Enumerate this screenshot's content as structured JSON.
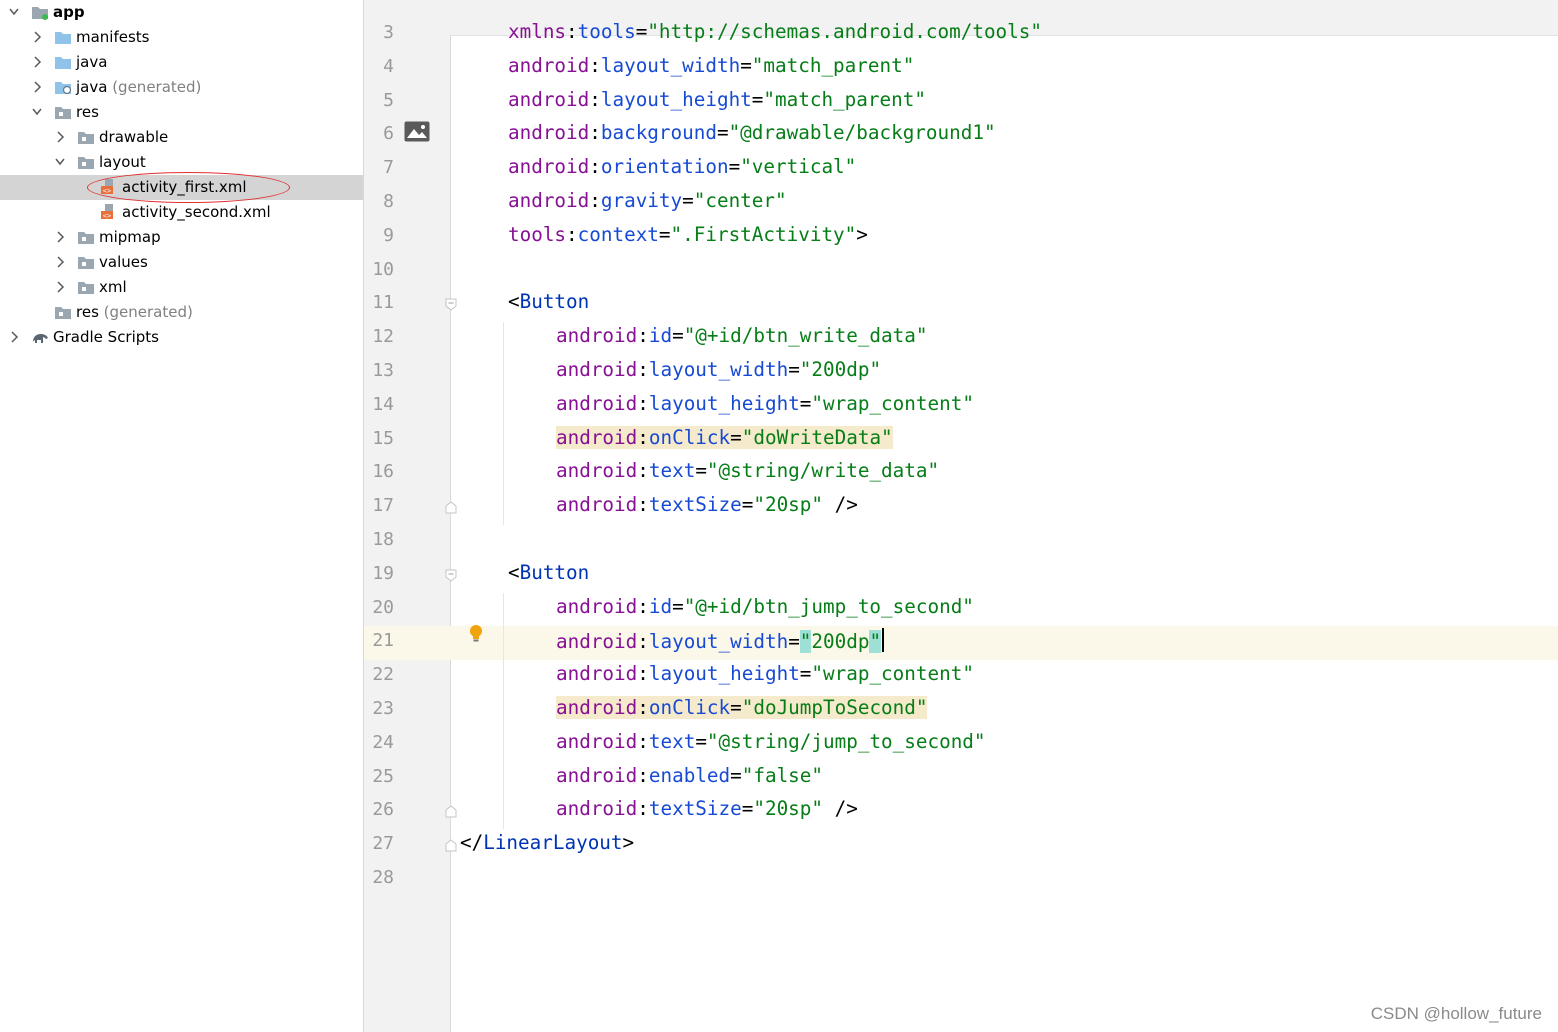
{
  "project_tree": [
    {
      "name": "tree-item-app",
      "label": "app",
      "icon": "module-folder-icon",
      "chevron": "down",
      "bold": true
    },
    {
      "name": "tree-item-manifests",
      "label": "manifests",
      "icon": "folder-icon",
      "chevron": "right"
    },
    {
      "name": "tree-item-java",
      "label": "java",
      "icon": "folder-icon",
      "chevron": "right"
    },
    {
      "name": "tree-item-java-generated",
      "label": "java",
      "suffix": "(generated)",
      "icon": "generated-java-folder-icon",
      "chevron": "right"
    },
    {
      "name": "tree-item-res",
      "label": "res",
      "icon": "resource-folder-icon",
      "chevron": "down"
    },
    {
      "name": "tree-item-drawable",
      "label": "drawable",
      "icon": "resource-folder-icon",
      "chevron": "right"
    },
    {
      "name": "tree-item-layout",
      "label": "layout",
      "icon": "resource-folder-icon",
      "chevron": "down"
    },
    {
      "name": "tree-item-activity-first",
      "label": "activity_first.xml",
      "icon": "xml-layout-file-icon",
      "selected": true
    },
    {
      "name": "tree-item-activity-second",
      "label": "activity_second.xml",
      "icon": "xml-layout-file-icon"
    },
    {
      "name": "tree-item-mipmap",
      "label": "mipmap",
      "icon": "resource-folder-icon",
      "chevron": "right"
    },
    {
      "name": "tree-item-values",
      "label": "values",
      "icon": "resource-folder-icon",
      "chevron": "right"
    },
    {
      "name": "tree-item-xml",
      "label": "xml",
      "icon": "resource-folder-icon",
      "chevron": "right"
    },
    {
      "name": "tree-item-res-generated",
      "label": "res",
      "suffix": "(generated)",
      "icon": "resource-folder-icon"
    },
    {
      "name": "tree-item-gradle-scripts",
      "label": "Gradle Scripts",
      "icon": "gradle-elephant-icon",
      "chevron": "right"
    }
  ],
  "editor": {
    "current_line": 21,
    "lines": [
      {
        "n": "3",
        "tokens": [
          [
            "ns",
            "xmlns"
          ],
          [
            "eq",
            ":"
          ],
          [
            "at",
            "tools"
          ],
          [
            "eq",
            "="
          ],
          [
            "st",
            "\"http://schemas.android.com/tools\""
          ]
        ]
      },
      {
        "n": "4",
        "tokens": [
          [
            "ns",
            "android"
          ],
          [
            "eq",
            ":"
          ],
          [
            "at",
            "layout_width"
          ],
          [
            "eq",
            "="
          ],
          [
            "st",
            "\"match_parent\""
          ]
        ]
      },
      {
        "n": "5",
        "tokens": [
          [
            "ns",
            "android"
          ],
          [
            "eq",
            ":"
          ],
          [
            "at",
            "layout_height"
          ],
          [
            "eq",
            "="
          ],
          [
            "st",
            "\"match_parent\""
          ]
        ]
      },
      {
        "n": "6",
        "tokens": [
          [
            "ns",
            "android"
          ],
          [
            "eq",
            ":"
          ],
          [
            "at",
            "background"
          ],
          [
            "eq",
            "="
          ],
          [
            "st",
            "\"@drawable/background1\""
          ]
        ]
      },
      {
        "n": "7",
        "tokens": [
          [
            "ns",
            "android"
          ],
          [
            "eq",
            ":"
          ],
          [
            "at",
            "orientation"
          ],
          [
            "eq",
            "="
          ],
          [
            "st",
            "\"vertical\""
          ]
        ]
      },
      {
        "n": "8",
        "tokens": [
          [
            "ns",
            "android"
          ],
          [
            "eq",
            ":"
          ],
          [
            "at",
            "gravity"
          ],
          [
            "eq",
            "="
          ],
          [
            "st",
            "\"center\""
          ]
        ]
      },
      {
        "n": "9",
        "tokens": [
          [
            "ns",
            "tools"
          ],
          [
            "eq",
            ":"
          ],
          [
            "at",
            "context"
          ],
          [
            "eq",
            "="
          ],
          [
            "st",
            "\".FirstActivity\""
          ],
          [
            "pu",
            ">"
          ]
        ]
      },
      {
        "n": "10",
        "tokens": []
      },
      {
        "n": "11",
        "tokens": [
          [
            "pu",
            "<"
          ],
          [
            "tg",
            "Button"
          ]
        ]
      },
      {
        "n": "12",
        "tokens": [
          [
            "ns",
            "android"
          ],
          [
            "eq",
            ":"
          ],
          [
            "at",
            "id"
          ],
          [
            "eq",
            "="
          ],
          [
            "st",
            "\"@+id/btn_write_data\""
          ]
        ]
      },
      {
        "n": "13",
        "tokens": [
          [
            "ns",
            "android"
          ],
          [
            "eq",
            ":"
          ],
          [
            "at",
            "layout_width"
          ],
          [
            "eq",
            "="
          ],
          [
            "st",
            "\"200dp\""
          ]
        ]
      },
      {
        "n": "14",
        "tokens": [
          [
            "ns",
            "android"
          ],
          [
            "eq",
            ":"
          ],
          [
            "at",
            "layout_height"
          ],
          [
            "eq",
            "="
          ],
          [
            "st",
            "\"wrap_content\""
          ]
        ]
      },
      {
        "n": "15",
        "highlight": true,
        "tokens": [
          [
            "ns",
            "android"
          ],
          [
            "eq",
            ":"
          ],
          [
            "at",
            "onClick"
          ],
          [
            "eq",
            "="
          ],
          [
            "st",
            "\"doWriteData\""
          ]
        ]
      },
      {
        "n": "16",
        "tokens": [
          [
            "ns",
            "android"
          ],
          [
            "eq",
            ":"
          ],
          [
            "at",
            "text"
          ],
          [
            "eq",
            "="
          ],
          [
            "st",
            "\"@string/write_data\""
          ]
        ]
      },
      {
        "n": "17",
        "tokens": [
          [
            "ns",
            "android"
          ],
          [
            "eq",
            ":"
          ],
          [
            "at",
            "textSize"
          ],
          [
            "eq",
            "="
          ],
          [
            "st",
            "\"20sp\""
          ],
          [
            "pu",
            " />"
          ]
        ]
      },
      {
        "n": "18",
        "tokens": []
      },
      {
        "n": "19",
        "tokens": [
          [
            "pu",
            "<"
          ],
          [
            "tg",
            "Button"
          ]
        ]
      },
      {
        "n": "20",
        "tokens": [
          [
            "ns",
            "android"
          ],
          [
            "eq",
            ":"
          ],
          [
            "at",
            "id"
          ],
          [
            "eq",
            "="
          ],
          [
            "st",
            "\"@+id/btn_jump_to_second\""
          ]
        ]
      },
      {
        "n": "21",
        "tokens": [
          [
            "ns",
            "android"
          ],
          [
            "eq",
            ":"
          ],
          [
            "at",
            "layout_width"
          ],
          [
            "eq",
            "="
          ],
          [
            "stq",
            "\""
          ],
          [
            "st",
            "200dp"
          ],
          [
            "stq",
            "\""
          ],
          [
            "caret",
            ""
          ]
        ]
      },
      {
        "n": "22",
        "tokens": [
          [
            "ns",
            "android"
          ],
          [
            "eq",
            ":"
          ],
          [
            "at",
            "layout_height"
          ],
          [
            "eq",
            "="
          ],
          [
            "st",
            "\"wrap_content\""
          ]
        ]
      },
      {
        "n": "23",
        "highlight": true,
        "tokens": [
          [
            "ns",
            "android"
          ],
          [
            "eq",
            ":"
          ],
          [
            "at",
            "onClick"
          ],
          [
            "eq",
            "="
          ],
          [
            "st",
            "\"doJumpToSecond\""
          ]
        ]
      },
      {
        "n": "24",
        "tokens": [
          [
            "ns",
            "android"
          ],
          [
            "eq",
            ":"
          ],
          [
            "at",
            "text"
          ],
          [
            "eq",
            "="
          ],
          [
            "st",
            "\"@string/jump_to_second\""
          ]
        ]
      },
      {
        "n": "25",
        "tokens": [
          [
            "ns",
            "android"
          ],
          [
            "eq",
            ":"
          ],
          [
            "at",
            "enabled"
          ],
          [
            "eq",
            "="
          ],
          [
            "st",
            "\"false\""
          ]
        ]
      },
      {
        "n": "26",
        "tokens": [
          [
            "ns",
            "android"
          ],
          [
            "eq",
            ":"
          ],
          [
            "at",
            "textSize"
          ],
          [
            "eq",
            "="
          ],
          [
            "st",
            "\"20sp\""
          ],
          [
            "pu",
            " />"
          ]
        ]
      },
      {
        "n": "27",
        "tokens": [
          [
            "pu",
            "</"
          ],
          [
            "tg",
            "LinearLayout"
          ],
          [
            "pu",
            ">"
          ]
        ]
      },
      {
        "n": "28",
        "tokens": []
      }
    ]
  },
  "watermark": "CSDN @hollow_future"
}
